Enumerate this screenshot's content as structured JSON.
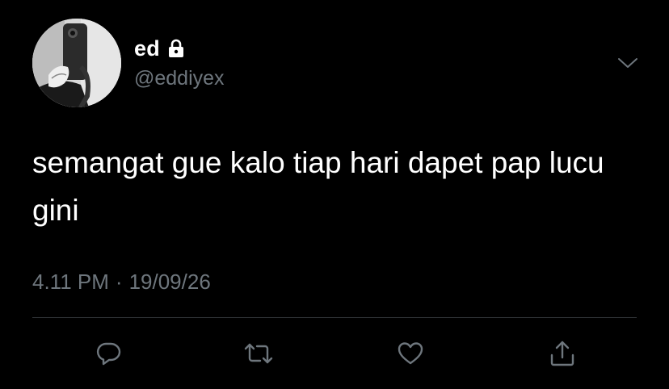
{
  "user": {
    "display_name": "ed",
    "handle": "@eddiyex",
    "protected": true
  },
  "tweet": {
    "text": "semangat gue kalo tiap hari dapet pap lucu gini",
    "time": "4.11 PM",
    "separator": "·",
    "date": "19/09/26"
  },
  "actions": [
    "reply-icon",
    "retweet-icon",
    "like-icon",
    "share-icon"
  ],
  "colors": {
    "background": "#000000",
    "text": "#ffffff",
    "secondary": "#6e767d",
    "divider": "#2f3336"
  }
}
